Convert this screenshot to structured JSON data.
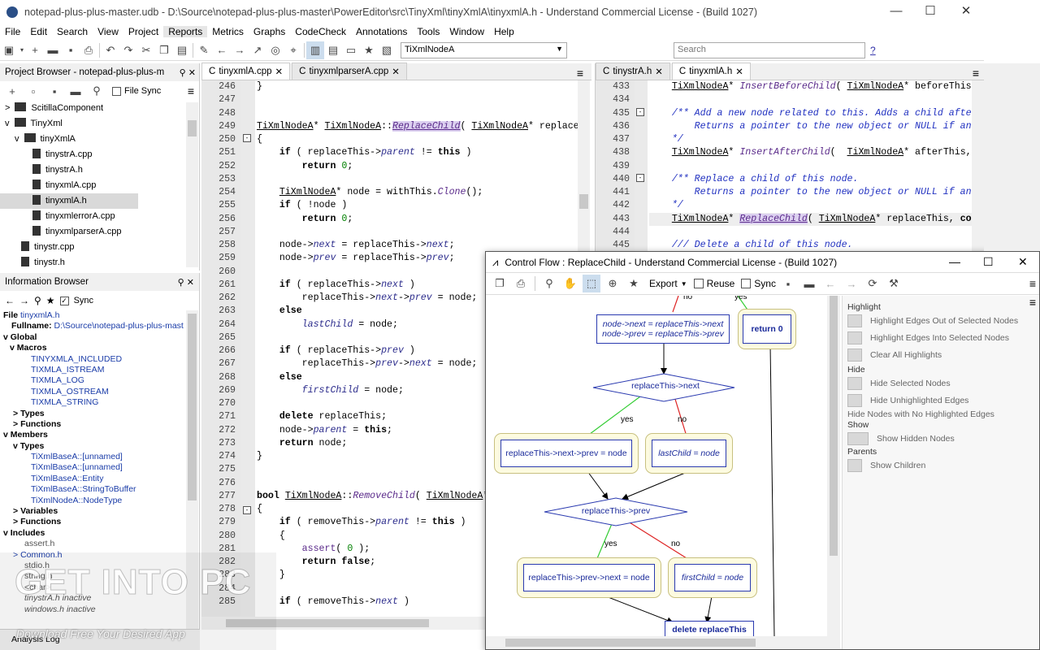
{
  "window": {
    "title": "notepad-plus-plus-master.udb - D:\\Source\\notepad-plus-plus-master\\PowerEditor\\src\\TinyXml\\tinyXmlA\\tinyxmlA.h - Understand Commercial License - (Build 1027)",
    "minimize": "—",
    "maximize": "☐",
    "close": "✕"
  },
  "menu": [
    "File",
    "Edit",
    "Search",
    "View",
    "Project",
    "Reports",
    "Metrics",
    "Graphs",
    "CodeCheck",
    "Annotations",
    "Tools",
    "Window",
    "Help"
  ],
  "toolbar": {
    "entity_combo": "TiXmlNodeA",
    "search_placeholder": "Search",
    "help": "?"
  },
  "project_browser": {
    "title": "Project Browser - notepad-plus-plus-m",
    "file_sync": "File Sync",
    "items": [
      {
        "label": "ScitillaComponent",
        "type": "folder",
        "expander": ">"
      },
      {
        "label": "TinyXml",
        "type": "folder",
        "expander": "v"
      },
      {
        "label": "tinyXmlA",
        "type": "folder",
        "expander": "v"
      },
      {
        "label": "tinystrA.cpp",
        "type": "file"
      },
      {
        "label": "tinystrA.h",
        "type": "file"
      },
      {
        "label": "tinyxmlA.cpp",
        "type": "file"
      },
      {
        "label": "tinyxmlA.h",
        "type": "file",
        "selected": true
      },
      {
        "label": "tinyxmlerrorA.cpp",
        "type": "file"
      },
      {
        "label": "tinyxmlparserA.cpp",
        "type": "file"
      },
      {
        "label": "tinystr.cpp",
        "type": "file"
      },
      {
        "label": "tinystr.h",
        "type": "file"
      }
    ]
  },
  "info_browser": {
    "title": "Information Browser",
    "sync": "Sync",
    "file_label": "File",
    "file_name": "tinyxmlA.h",
    "fullname_label": "Fullname:",
    "fullname": "D:\\Source\\notepad-plus-plus-mast",
    "global": "Global",
    "macros": "Macros",
    "macro_items": [
      "TINYXMLA_INCLUDED",
      "TIXMLA_ISTREAM",
      "TIXMLA_LOG",
      "TIXMLA_OSTREAM",
      "TIXMLA_STRING"
    ],
    "types": "Types",
    "functions": "Functions",
    "members": "Members",
    "member_types": [
      "TiXmlBaseA::[unnamed]",
      "TiXmlBaseA::[unnamed]",
      "TiXmlBaseA::Entity",
      "TiXmlBaseA::StringToBuffer",
      "TiXmlNodeA::NodeType"
    ],
    "variables": "Variables",
    "includes": "Includes",
    "include_items": [
      "assert.h",
      "Common.h",
      "stdio.h",
      "string.h",
      "<char>",
      "tinystrA.h  inactive",
      "windows.h  inactive"
    ],
    "analysis_log": "Analysis Log"
  },
  "editor_left": {
    "tabs": [
      "tinyxmlA.cpp",
      "tinyxmlparserA.cpp"
    ],
    "line_numbers": [
      "246",
      "247",
      "248",
      "249",
      "250",
      "251",
      "252",
      "253",
      "254",
      "255",
      "256",
      "257",
      "258",
      "259",
      "260",
      "261",
      "262",
      "263",
      "264",
      "265",
      "266",
      "267",
      "268",
      "269",
      "270",
      "271",
      "272",
      "273",
      "274",
      "275",
      "276",
      "277",
      "278",
      "279",
      "280",
      "281",
      "282",
      "283",
      "284",
      "285"
    ]
  },
  "editor_right": {
    "tabs": [
      "tinystrA.h",
      "tinyxmlA.h"
    ],
    "line_numbers": [
      "433",
      "434",
      "435",
      "436",
      "437",
      "438",
      "439",
      "440",
      "441",
      "442",
      "443",
      "444",
      "445"
    ]
  },
  "control_flow": {
    "title": "Control Flow : ReplaceChild - Understand Commercial License - (Build 1027)",
    "export": "Export",
    "reuse": "Reuse",
    "sync": "Sync",
    "nodes": {
      "assign": [
        "node->next = replaceThis->next",
        "node->prev = replaceThis->prev"
      ],
      "return0": "return 0",
      "decision1": "replaceThis->next",
      "yes1": "replaceThis->next->prev = node",
      "no1": "lastChild = node",
      "decision2": "replaceThis->prev",
      "yes2": "replaceThis->prev->next = node",
      "no2": "firstChild = node",
      "delete": "delete replaceThis"
    },
    "labels": {
      "yes": "yes",
      "no": "no"
    },
    "highlight_title": "Highlight",
    "highlight_items": [
      "Highlight Edges Out of Selected Nodes",
      "Highlight Edges Into Selected Nodes",
      "Clear All Highlights"
    ],
    "hide_title": "Hide",
    "hide_items": [
      "Hide Selected Nodes",
      "Hide Unhighlighted Edges",
      "Hide Nodes with No Highlighted Edges"
    ],
    "show_title": "Show",
    "show_items": [
      "Show Hidden Nodes"
    ],
    "parents_title": "Parents",
    "parents_items": [
      "Show Children"
    ]
  },
  "watermark": {
    "main": "GET INTO PC",
    "sub": "Download Free Your Desired App"
  },
  "colors": {
    "yes_edge": "#33cc33",
    "no_edge": "#dd2222",
    "node_border": "#2a3ab0",
    "node_fill": "#fdfbe0"
  }
}
